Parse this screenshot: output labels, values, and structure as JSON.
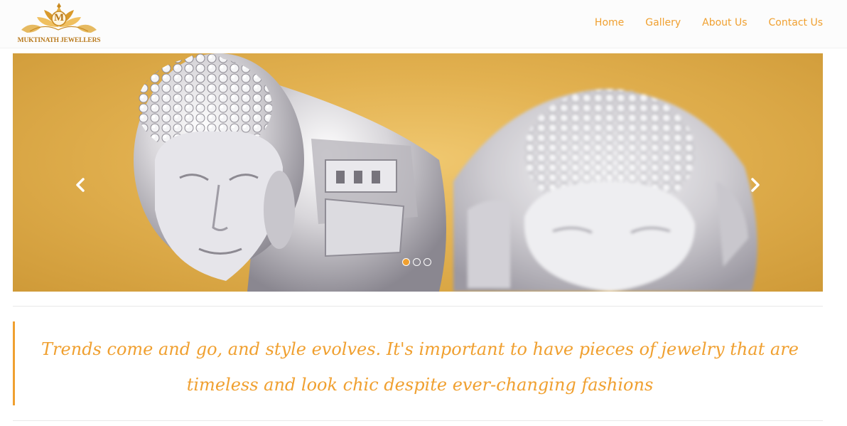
{
  "brand": {
    "logo_letter": "M",
    "name": "MUKTINATH JEWELLERS",
    "gold_color": "#c98a22"
  },
  "nav": {
    "items": [
      {
        "label": "Home"
      },
      {
        "label": "Gallery"
      },
      {
        "label": "About Us"
      },
      {
        "label": "Contact Us"
      }
    ],
    "accent": "#f0a030"
  },
  "carousel": {
    "image_subject": "silver-buddha-rings",
    "prev_icon": "chevron-left-icon",
    "next_icon": "chevron-right-icon",
    "slide_count": 3,
    "active_slide": 1
  },
  "quote": {
    "text": "Trends come and go, and style evolves. It's important to have pieces of jewelry that are timeless and look chic despite ever-changing fashions"
  }
}
